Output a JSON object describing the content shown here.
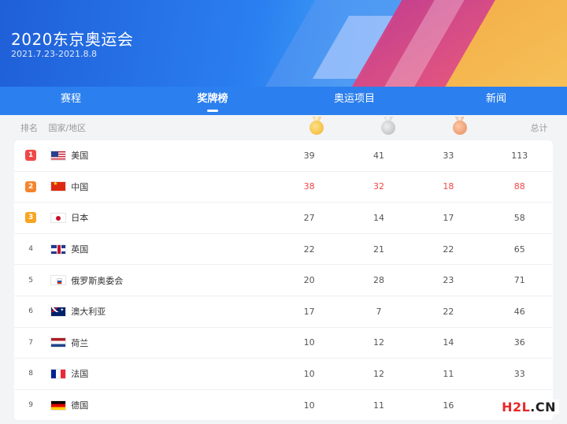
{
  "banner": {
    "title": "2020东京奥运会",
    "dates": "2021.7.23-2021.8.8"
  },
  "tabs": [
    {
      "label": "赛程",
      "active": false
    },
    {
      "label": "奖牌榜",
      "active": true
    },
    {
      "label": "奥运项目",
      "active": false
    },
    {
      "label": "新闻",
      "active": false
    }
  ],
  "table_header": {
    "rank": "排名",
    "country": "国家/地区",
    "gold_icon": "gold-medal-icon",
    "silver_icon": "silver-medal-icon",
    "bronze_icon": "bronze-medal-icon",
    "total": "总计"
  },
  "rows": [
    {
      "rank": "1",
      "flag": "us",
      "country": "美国",
      "gold": "39",
      "silver": "41",
      "bronze": "33",
      "total": "113"
    },
    {
      "rank": "2",
      "flag": "cn",
      "country": "中国",
      "gold": "38",
      "silver": "32",
      "bronze": "18",
      "total": "88",
      "highlight": true
    },
    {
      "rank": "3",
      "flag": "jp",
      "country": "日本",
      "gold": "27",
      "silver": "14",
      "bronze": "17",
      "total": "58"
    },
    {
      "rank": "4",
      "flag": "gb",
      "country": "英国",
      "gold": "22",
      "silver": "21",
      "bronze": "22",
      "total": "65"
    },
    {
      "rank": "5",
      "flag": "roc",
      "country": "俄罗斯奥委会",
      "gold": "20",
      "silver": "28",
      "bronze": "23",
      "total": "71"
    },
    {
      "rank": "6",
      "flag": "au",
      "country": "澳大利亚",
      "gold": "17",
      "silver": "7",
      "bronze": "22",
      "total": "46"
    },
    {
      "rank": "7",
      "flag": "nl",
      "country": "荷兰",
      "gold": "10",
      "silver": "12",
      "bronze": "14",
      "total": "36"
    },
    {
      "rank": "8",
      "flag": "fr",
      "country": "法国",
      "gold": "10",
      "silver": "12",
      "bronze": "11",
      "total": "33"
    },
    {
      "rank": "9",
      "flag": "de",
      "country": "德国",
      "gold": "10",
      "silver": "11",
      "bronze": "16",
      "total": ""
    }
  ],
  "watermark": {
    "part_a": "H2L",
    "part_b": ".CN"
  },
  "colors": {
    "accent": "#2b7fee",
    "highlight": "#f04848"
  }
}
